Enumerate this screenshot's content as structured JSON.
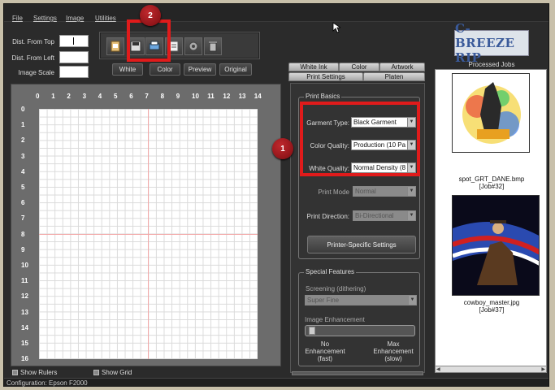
{
  "menu": [
    "File",
    "Settings",
    "Image",
    "Utilities"
  ],
  "fields": {
    "dist_top_label": "Dist. From Top",
    "dist_left_label": "Dist. From Left",
    "image_scale_label": "Image Scale"
  },
  "view_buttons": [
    "White",
    "Color",
    "Preview",
    "Original"
  ],
  "ruler": {
    "top": [
      "0",
      "1",
      "2",
      "3",
      "4",
      "5",
      "6",
      "7",
      "8",
      "9",
      "10",
      "11",
      "12",
      "13",
      "14"
    ],
    "left": [
      "0",
      "1",
      "2",
      "3",
      "4",
      "5",
      "6",
      "7",
      "8",
      "9",
      "10",
      "11",
      "12",
      "13",
      "14",
      "15",
      "16"
    ]
  },
  "bottom": {
    "show_rulers": "Show Rulers",
    "show_grid": "Show Grid"
  },
  "status": "Configuration: Epson F2000",
  "tabs": {
    "white_ink": "White Ink",
    "color": "Color",
    "artwork": "Artwork",
    "print_settings": "Print Settings",
    "platen": "Platen"
  },
  "print_basics": {
    "title": "Print Basics",
    "garment_type_label": "Garment Type:",
    "garment_type_value": "Black Garment",
    "color_quality_label": "Color Quality:",
    "color_quality_value": "Production (10 Pa",
    "white_quality_label": "White Quality:",
    "white_quality_value": "Normal Density (8",
    "print_mode_label": "Print Mode",
    "print_mode_value": "Normal",
    "print_direction_label": "Print Direction:",
    "print_direction_value": "Bi-Directional",
    "printer_specific_button": "Printer-Specific Settings"
  },
  "special_features": {
    "title": "Special Features",
    "screening_label": "Screening (dithering)",
    "screening_value": "Super Fine",
    "image_enhancement_label": "Image Enhancement",
    "enhancement_level": 0,
    "min_label": "No\nEnhancement\n(fast)",
    "max_label": "Max\nEnhancement\n(slow)"
  },
  "logo": "C-BREEZE RIP",
  "processed_jobs": {
    "title": "Processed Jobs",
    "jobs": [
      {
        "name": "spot_GRT_DANE.bmp",
        "id": "[Job#32]"
      },
      {
        "name": "cowboy_master.jpg",
        "id": "[Job#37]"
      }
    ]
  },
  "annotations": {
    "badge1": "1",
    "badge2": "2",
    "highlight_color": "#e01b1b"
  },
  "colors": {
    "app_bg": "#2b2b2b",
    "outer_bg": "#c8c0aa"
  }
}
